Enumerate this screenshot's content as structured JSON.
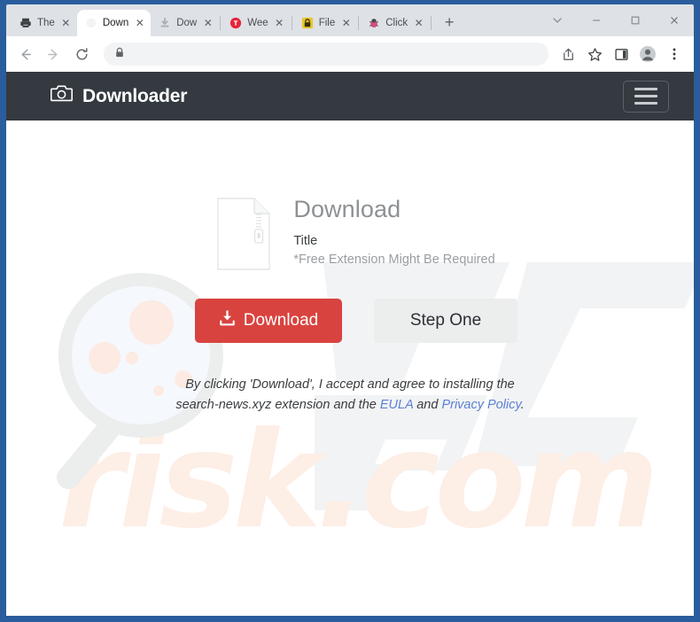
{
  "browser": {
    "tabs": [
      {
        "title": "The ",
        "favicon": "printer-icon",
        "active": false
      },
      {
        "title": "Down",
        "favicon": "page-icon",
        "active": true
      },
      {
        "title": "Dow",
        "favicon": "download-icon",
        "active": false
      },
      {
        "title": "Wee",
        "favicon": "red-circle-icon",
        "active": false
      },
      {
        "title": "File ",
        "favicon": "yellow-lock-icon",
        "active": false
      },
      {
        "title": "Click",
        "favicon": "bug-icon",
        "active": false
      }
    ],
    "new_tab_label": "+",
    "close_label": "✕",
    "window_controls": {
      "tab_search": "tab-search-chevron",
      "minimize": "–",
      "maximize": "□",
      "close": "✕"
    },
    "toolbar": {
      "back": "back-arrow",
      "forward": "forward-arrow",
      "reload": "reload-arrow",
      "site_info": "lock-icon",
      "url": "",
      "url_placeholder": "",
      "share": "share-icon",
      "bookmark": "star-icon",
      "side_panel": "side-panel-icon",
      "profile": "profile-avatar",
      "menu": "three-dot-menu"
    }
  },
  "site": {
    "header": {
      "brand_label": "Downloader",
      "brand_icon": "camera-icon",
      "menu_button": "hamburger-menu"
    },
    "download": {
      "file_icon": "zip-file-icon",
      "heading": "Download",
      "subtitle": "Title",
      "note": "*Free Extension Might Be Required",
      "primary_button": "Download",
      "primary_button_icon": "download-arrow-icon",
      "secondary_button": "Step One"
    },
    "disclaimer": {
      "part1": "By clicking 'Download', I accept and agree to installing the search-news.xyz extension and the ",
      "link1": "EULA",
      "part2": " and ",
      "link2": "Privacy Policy",
      "part3": "."
    },
    "watermark": {
      "text": "risk.com",
      "logo": "PC"
    }
  },
  "colors": {
    "frame_blue": "#2a5d9c",
    "header_dark": "#343a40",
    "accent_red": "#d9433f",
    "link_blue": "#5a7fd6",
    "watermark_pink": "#fdeee6",
    "watermark_grey": "#f2f3f4"
  }
}
